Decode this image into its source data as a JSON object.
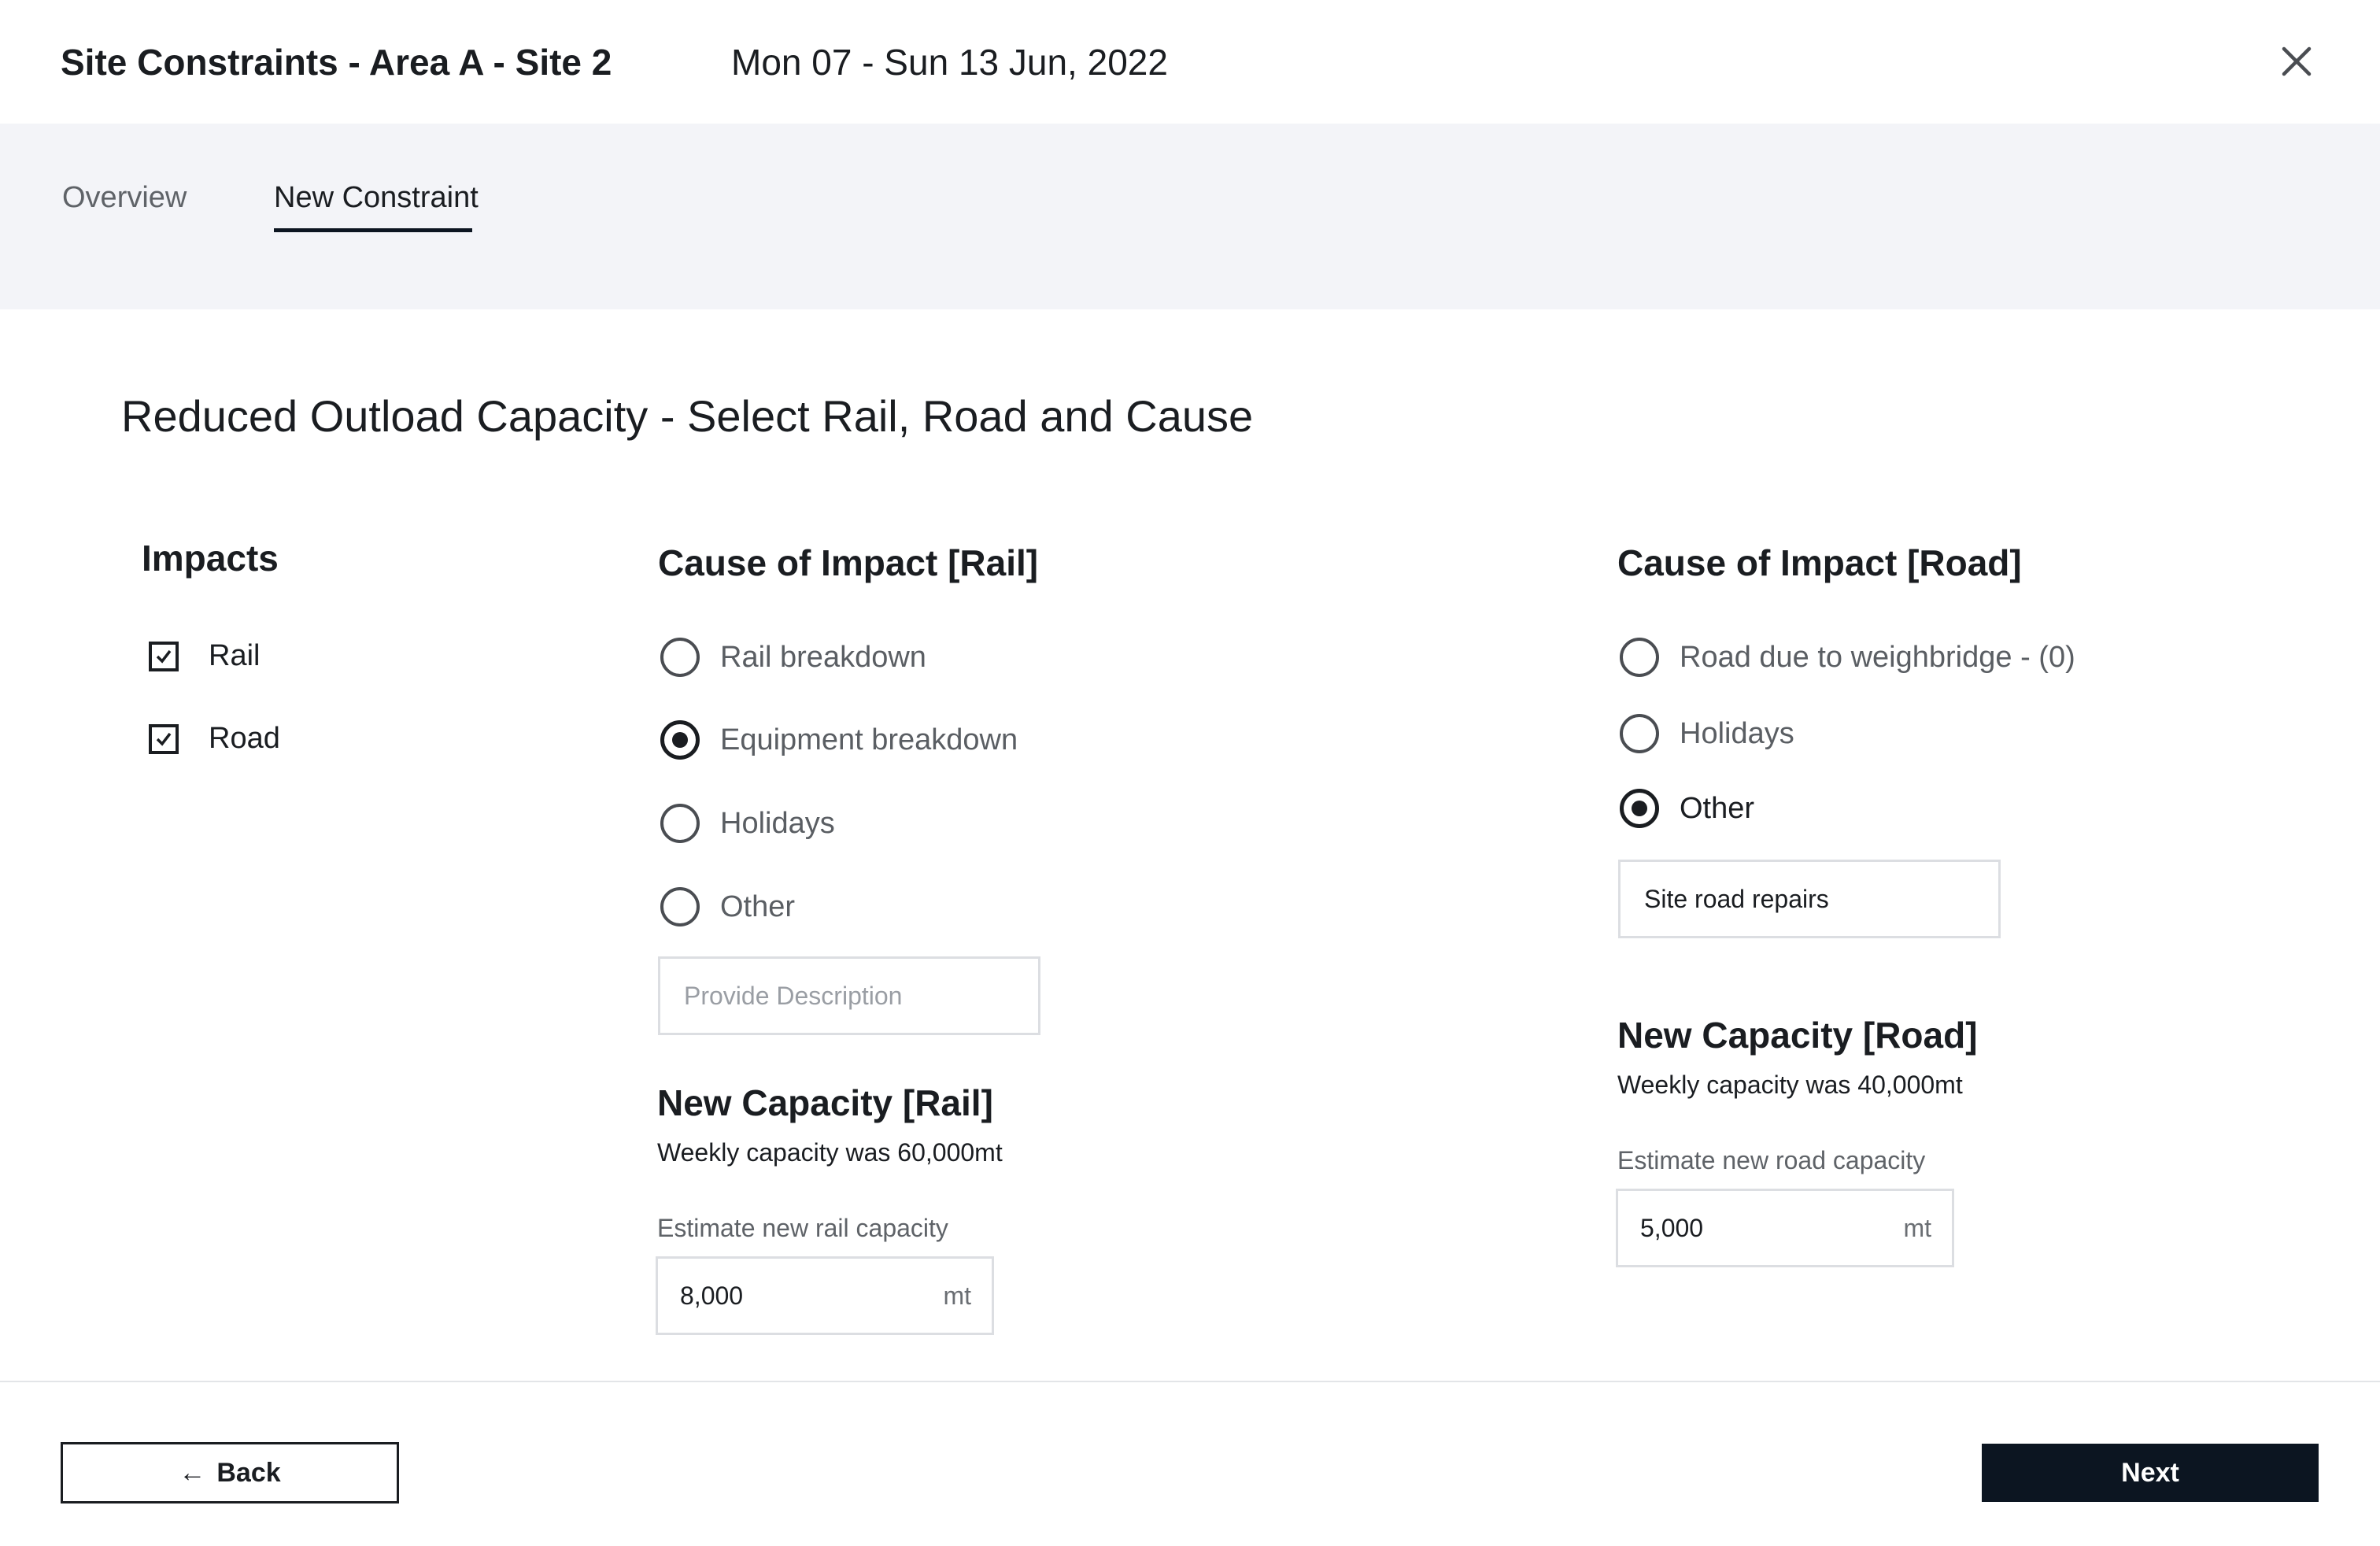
{
  "header": {
    "title": "Site Constraints - Area A - Site 2",
    "date_range": "Mon 07 - Sun 13 Jun, 2022",
    "close_icon": "close-icon"
  },
  "tabs": [
    {
      "label": "Overview",
      "active": false
    },
    {
      "label": "New Constraint",
      "active": true
    }
  ],
  "main": {
    "title": "Reduced Outload Capacity - Select Rail, Road and Cause",
    "impacts": {
      "heading": "Impacts",
      "options": [
        {
          "label": "Rail",
          "checked": true
        },
        {
          "label": "Road",
          "checked": true
        }
      ]
    },
    "rail": {
      "heading": "Cause of Impact [Rail]",
      "options": [
        {
          "label": "Rail breakdown",
          "selected": false
        },
        {
          "label": "Equipment breakdown",
          "selected": true
        },
        {
          "label": "Holidays",
          "selected": false
        },
        {
          "label": "Other",
          "selected": false
        }
      ],
      "description_value": "",
      "description_placeholder": "Provide Description",
      "capacity_heading": "New Capacity [Rail]",
      "capacity_note": "Weekly capacity was 60,000mt",
      "estimate_label": "Estimate new rail capacity",
      "estimate_value": "8,000",
      "unit": "mt"
    },
    "road": {
      "heading": "Cause of Impact [Road]",
      "options": [
        {
          "label": "Road due to weighbridge - (0)",
          "selected": false
        },
        {
          "label": "Holidays",
          "selected": false
        },
        {
          "label": "Other",
          "selected": true
        }
      ],
      "description_value": "Site road repairs",
      "capacity_heading": "New Capacity [Road]",
      "capacity_note": "Weekly capacity was 40,000mt",
      "estimate_label": "Estimate new road capacity",
      "estimate_value": "5,000",
      "unit": "mt"
    }
  },
  "footer": {
    "back_label": "Back",
    "back_icon": "arrow-left-icon",
    "next_label": "Next"
  },
  "colors": {
    "accent": "#0c1521",
    "tab_band": "#f3f4f8",
    "muted_text": "#5f6368",
    "input_border": "#dcdee2"
  }
}
